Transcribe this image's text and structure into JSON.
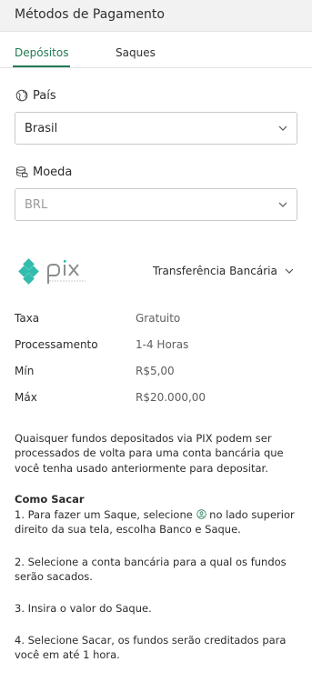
{
  "header": {
    "title": "Métodos de Pagamento"
  },
  "tabs": [
    {
      "label": "Depósitos",
      "active": true
    },
    {
      "label": "Saques",
      "active": false
    }
  ],
  "country": {
    "label": "País",
    "icon": "globe-icon",
    "value": "Brasil"
  },
  "currency": {
    "label": "Moeda",
    "icon": "coins-icon",
    "value": "BRL"
  },
  "method": {
    "logo": "pix-logo",
    "selected": "Transferência Bancária"
  },
  "details": [
    {
      "key": "Taxa",
      "value": "Gratuito"
    },
    {
      "key": "Processamento",
      "value": "1-4 Horas"
    },
    {
      "key": "Mín",
      "value": "R$5,00"
    },
    {
      "key": "Máx",
      "value": "R$20.000,00"
    }
  ],
  "note": "Quaisquer fundos depositados via PIX podem ser processados de volta para uma conta bancária que você tenha usado anteriormente para depositar.",
  "how_to": {
    "title": "Como Sacar",
    "step1_before": "1. Para fazer um Saque, selecione ",
    "step1_after": " no lado superior direito da sua tela, escolha Banco e Saque.",
    "step2": "2. Selecione a conta bancária para a qual os fundos serão sacados.",
    "step3": "3. Insira o valor do Saque.",
    "step4": "4. Selecione Sacar, os fundos serão creditados para você em até 1 hora."
  },
  "colors": {
    "accent": "#1f7a50",
    "pix_teal": "#32bcad"
  }
}
